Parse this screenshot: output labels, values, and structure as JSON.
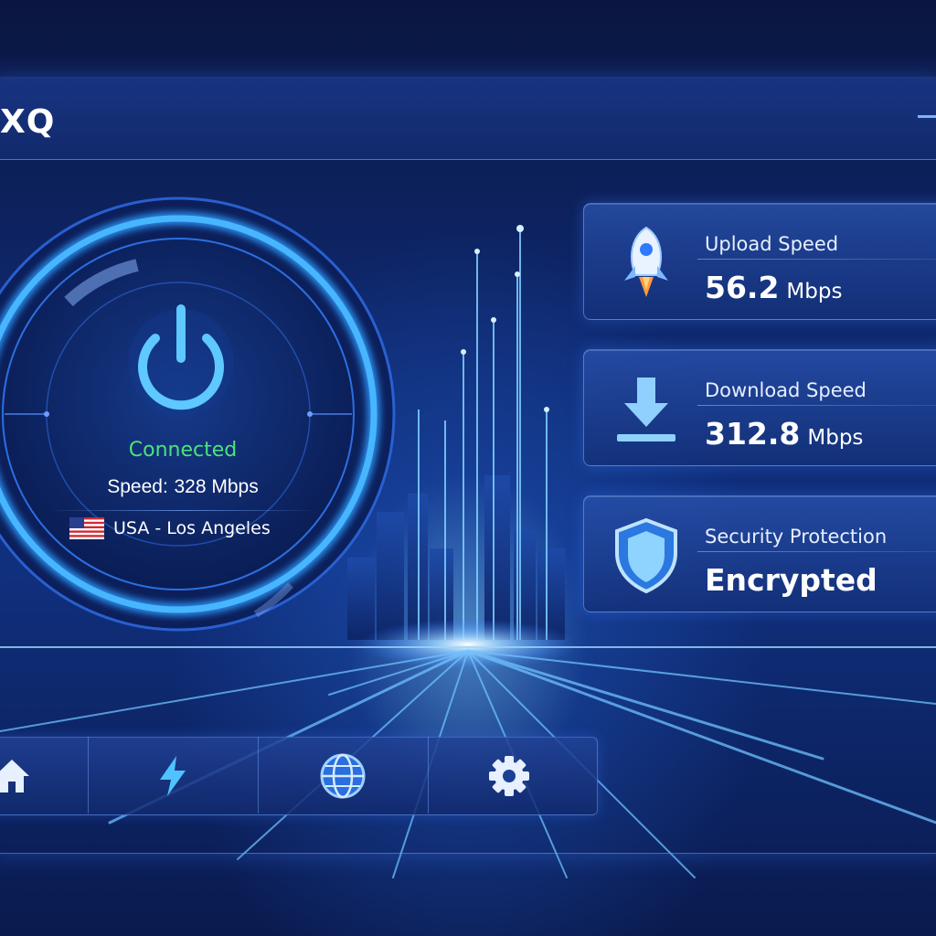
{
  "app": {
    "title": "XQ"
  },
  "connection": {
    "status": "Connected",
    "speed_label": "Speed:",
    "speed_value": "328 Mbps",
    "location": "USA - Los Angeles",
    "flag": "us-flag"
  },
  "stats": {
    "upload": {
      "label": "Upload Speed",
      "value": "56.2",
      "unit": "Mbps",
      "icon": "rocket-icon"
    },
    "download": {
      "label": "Download Speed",
      "value": "312.8",
      "unit": "Mbps",
      "icon": "download-icon"
    },
    "security": {
      "label": "Security Protection",
      "value": "Encrypted",
      "icon": "shield-icon"
    }
  },
  "nav": {
    "items": [
      {
        "name": "home",
        "icon": "home-icon"
      },
      {
        "name": "speed",
        "icon": "lightning-icon"
      },
      {
        "name": "servers",
        "icon": "globe-icon"
      },
      {
        "name": "settings",
        "icon": "gear-icon"
      }
    ]
  },
  "colors": {
    "accent": "#2f9bff",
    "connected": "#4be37c",
    "background": "#0b1a45"
  }
}
